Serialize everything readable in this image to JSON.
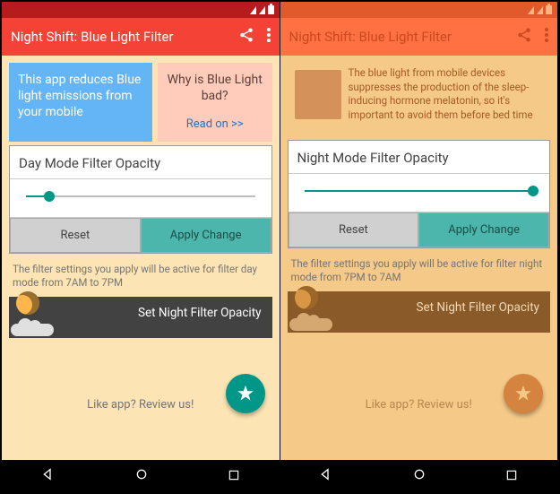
{
  "left": {
    "header": {
      "title": "Night Shift: Blue Light Filter"
    },
    "info": {
      "card1": "This app reduces Blue light emissions from your mobile",
      "card2_title": "Why is Blue Light bad?",
      "card2_link": "Read on >>"
    },
    "panel": {
      "title": "Day Mode Filter Opacity",
      "slider_pct": 10,
      "reset": "Reset",
      "apply": "Apply Change",
      "hint": "The filter settings you apply will be active for filter day mode from 7AM to 7PM"
    },
    "night_banner": "Set Night Filter Opacity",
    "review": "Like app? Review us!"
  },
  "right": {
    "header": {
      "title": "Night Shift: Blue Light Filter"
    },
    "info": {
      "text": "The blue light from mobile devices suppresses the production of the sleep-inducing hormone melatonin, so it's important to avoid them before bed time"
    },
    "panel": {
      "title": "Night Mode Filter Opacity",
      "slider_pct": 100,
      "reset": "Reset",
      "apply": "Apply Change",
      "hint": "The filter settings you apply will be active for filter night mode from 7PM to 7AM"
    },
    "night_banner": "Set Night Filter Opacity",
    "review": "Like app? Review us!"
  }
}
